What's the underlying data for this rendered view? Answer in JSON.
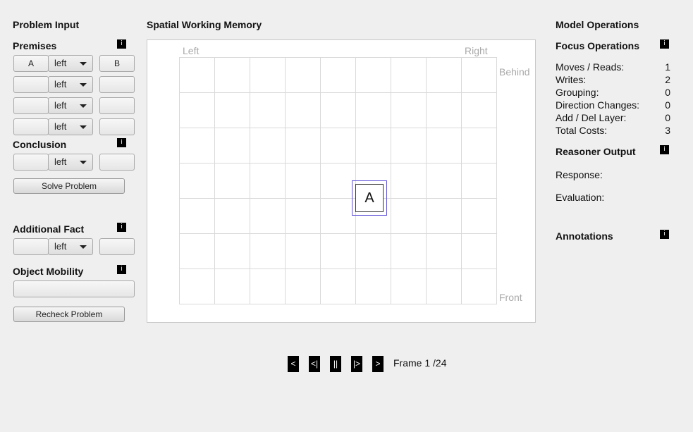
{
  "left_panel": {
    "title": "Problem Input",
    "premises_title": "Premises",
    "premises": [
      {
        "a": "A",
        "relation": "left",
        "b": "B"
      },
      {
        "a": "",
        "relation": "left",
        "b": ""
      },
      {
        "a": "",
        "relation": "left",
        "b": ""
      },
      {
        "a": "",
        "relation": "left",
        "b": ""
      }
    ],
    "conclusion_title": "Conclusion",
    "conclusion": {
      "a": "",
      "relation": "left",
      "b": ""
    },
    "solve_button": "Solve Problem",
    "additional_title": "Additional Fact",
    "additional": {
      "a": "",
      "relation": "left",
      "b": ""
    },
    "mobility_title": "Object Mobility",
    "mobility_value": "",
    "recheck_button": "Recheck Problem",
    "info_glyph": "i"
  },
  "workspace": {
    "title": "Spatial Working Memory",
    "labels": {
      "left": "Left",
      "right": "Right",
      "behind": "Behind",
      "front": "Front"
    },
    "grid": {
      "columns": 9,
      "rows": 7
    },
    "objects": [
      {
        "label": "A",
        "column": 5,
        "row": 4,
        "focused": true
      }
    ]
  },
  "playback": {
    "buttons": [
      "<",
      "<|",
      "||",
      "|>",
      ">"
    ],
    "frame_label": "Frame 1 /24"
  },
  "right_panel": {
    "title": "Model Operations",
    "focus_title": "Focus Operations",
    "stats": [
      {
        "label": "Moves / Reads:",
        "value": "1"
      },
      {
        "label": "Writes:",
        "value": "2"
      },
      {
        "label": "Grouping:",
        "value": "0"
      },
      {
        "label": "Direction Changes:",
        "value": "0"
      },
      {
        "label": "Add / Del Layer:",
        "value": "0"
      },
      {
        "label": "Total Costs:",
        "value": "3"
      }
    ],
    "reasoner_title": "Reasoner Output",
    "response_label": "Response:",
    "evaluation_label": "Evaluation:",
    "annotations_title": "Annotations"
  },
  "colors": {
    "focus_border": "#5b4fd6",
    "grid_line": "#d9d9d9"
  }
}
